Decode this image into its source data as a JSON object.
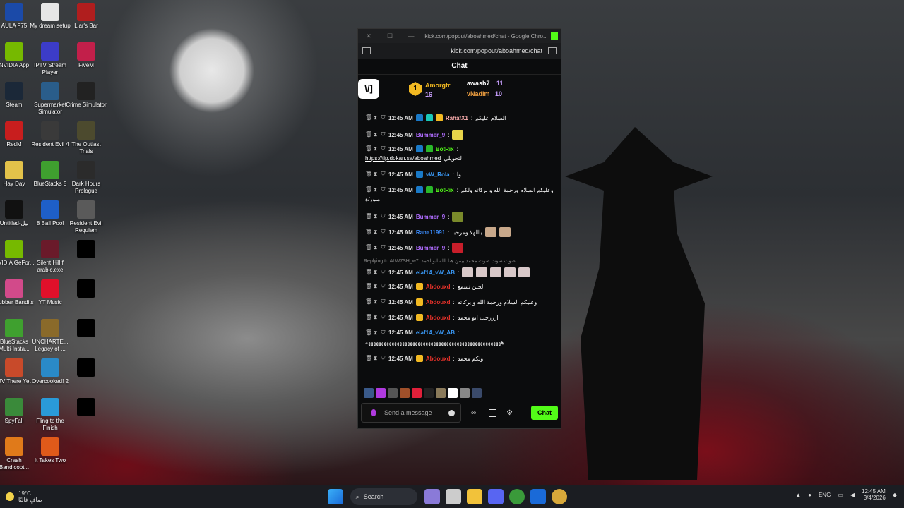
{
  "desktop": {
    "icons": [
      {
        "label": "AULA F75",
        "color": "#1b4aa8"
      },
      {
        "label": "My dream setup",
        "color": "#e6e6e6"
      },
      {
        "label": "Liar's Bar",
        "color": "#b01e1e"
      },
      {
        "label": "NVIDIA App",
        "color": "#76b900"
      },
      {
        "label": "IPTV Stream Player",
        "color": "#3c3cc8"
      },
      {
        "label": "FiveM",
        "color": "#c21f4a"
      },
      {
        "label": "Steam",
        "color": "#1b2838"
      },
      {
        "label": "Supermarket Simulator",
        "color": "#2a5d8a"
      },
      {
        "label": "Crime Simulator",
        "color": "#222222"
      },
      {
        "label": "RedM",
        "color": "#c81e1e"
      },
      {
        "label": "Resident Evil 4",
        "color": "#3a3a3a"
      },
      {
        "label": "The Outlast Trials",
        "color": "#4c4a2e"
      },
      {
        "label": "Hay Day",
        "color": "#e3c24a"
      },
      {
        "label": "BlueStacks 5",
        "color": "#3fa02f"
      },
      {
        "label": "Dark Hours Prologue",
        "color": "#2b2b2b"
      },
      {
        "label": "Untitled-بيل",
        "color": "#111111"
      },
      {
        "label": "8 Ball Pool",
        "color": "#1e5fc8"
      },
      {
        "label": "Resident Evil Requiem",
        "color": "#5a5a5a"
      },
      {
        "label": "NVIDIA GeFor...",
        "color": "#76b900"
      },
      {
        "label": "Silent Hill f arabic.exe",
        "color": "#6a1a2a"
      },
      {
        "label": "",
        "color": "#000000"
      },
      {
        "label": "Rubber Bandits",
        "color": "#d24a8a"
      },
      {
        "label": "YT Music",
        "color": "#e0102a"
      },
      {
        "label": "",
        "color": "#000000"
      },
      {
        "label": "BlueStacks Multi-Insta...",
        "color": "#3fa02f"
      },
      {
        "label": "UNCHARTE... Legacy of ...",
        "color": "#8a6a2a"
      },
      {
        "label": "",
        "color": "#000000"
      },
      {
        "label": "RV There Yet",
        "color": "#c84a2a"
      },
      {
        "label": "Overcooked! 2",
        "color": "#2a8ac8"
      },
      {
        "label": "",
        "color": "#000000"
      },
      {
        "label": "SpyFall",
        "color": "#3a8a3a"
      },
      {
        "label": "Fling to the Finish",
        "color": "#2a9ad8"
      },
      {
        "label": "",
        "color": "#000000"
      },
      {
        "label": "Crash Bandicoot...",
        "color": "#e07a1a"
      },
      {
        "label": "It Takes Two",
        "color": "#e05a1a"
      }
    ]
  },
  "browser": {
    "window_title": "kick.com/popout/aboahmed/chat - Google Chro...",
    "url": "kick.com/popout/aboahmed/chat",
    "close_glyph": "✕",
    "restore_glyph": "☐",
    "min_glyph": "—"
  },
  "chat": {
    "header": "Chat",
    "logo_text": "\\/]",
    "gifter_rank": "1",
    "gifters": {
      "first": {
        "name": "Amorgtr",
        "count": "16"
      },
      "second": {
        "name": "awash7",
        "count": "11"
      },
      "third": {
        "name": "vNadim",
        "count": "10"
      }
    },
    "messages": [
      {
        "time": "12:45 AM",
        "user": "RahafX1",
        "color": "#ffb0b0",
        "text": "السلام عليكم",
        "badges": [
          "#1a7ac8",
          "#1ac8b8",
          "#f2b922"
        ]
      },
      {
        "time": "12:45 AM",
        "user": "Bummer_9",
        "color": "#b06cff",
        "text": "",
        "emotes": [
          "#e8d44a"
        ]
      },
      {
        "time": "12:45 AM",
        "user": "BotRix",
        "color": "#53fc18",
        "text": "",
        "badges": [
          "#1a7ac8",
          "#2ab82a"
        ],
        "line2_link": "https://tip.dokan.sa/aboahmed",
        "line2_text": "لتحويلي"
      },
      {
        "time": "12:45 AM",
        "user": "vW_Rola",
        "color": "#3a9af8",
        "text": "وا",
        "badges": [
          "#1a7ac8"
        ]
      },
      {
        "time": "12:45 AM",
        "user": "BotRix",
        "color": "#53fc18",
        "text": "وعليكم السلام ورحمة الله و بركاته ولكم",
        "badges": [
          "#1a7ac8",
          "#2ab82a"
        ],
        "line2_text": "منور/ة"
      },
      {
        "time": "12:45 AM",
        "user": "Bummer_9",
        "color": "#b06cff",
        "text": "",
        "emotes": [
          "#7a8a2a"
        ]
      },
      {
        "time": "12:45 AM",
        "user": "Rana11991",
        "color": "#3a8af8",
        "text": "ياالهلا ومرحبا",
        "emotes": [
          "#c8a88a",
          "#c8a88a"
        ]
      },
      {
        "time": "12:45 AM",
        "user": "Bummer_9",
        "color": "#b06cff",
        "text": "",
        "emotes": [
          "#c81e2a"
        ]
      },
      {
        "time": "12:45 AM",
        "user": "elaf14_vW_AB",
        "color": "#3a9af8",
        "text": "",
        "reply": "Replying to ALW7SH_w7: صوت صوت صوت محمد بيتنن هنا الله ابو احمد",
        "emotes": [
          "#d8c8c8",
          "#d8c8c8",
          "#d8c8c8",
          "#d8c8c8",
          "#d8c8c8"
        ]
      },
      {
        "time": "12:45 AM",
        "user": "Abdouxd",
        "color": "#e8322a",
        "text": "الجين تسمع",
        "badges": [
          "#f2b922"
        ]
      },
      {
        "time": "12:45 AM",
        "user": "Abdouxd",
        "color": "#e8322a",
        "text": "وعليكم السلام ورحمة الله و بركاته",
        "badges": [
          "#f2b922"
        ]
      },
      {
        "time": "12:45 AM",
        "user": "Abdouxd",
        "color": "#e8322a",
        "text": "ارررحب ابو محمد",
        "badges": [
          "#f2b922"
        ]
      },
      {
        "time": "12:45 AM",
        "user": "elaf14_vW_AB",
        "color": "#3a9af8",
        "text": "",
        "line2_text": "ههههههههههههههههههههههههههههههههههههههههههههههههههههه"
      },
      {
        "time": "12:45 AM",
        "user": "Abdouxd",
        "color": "#e8322a",
        "text": "ولكم محمد",
        "badges": [
          "#f2b922"
        ]
      }
    ],
    "emote_bar": [
      "#3a5a8a",
      "#b03adf",
      "#555555",
      "#a0502a",
      "#e0203a",
      "#222222",
      "#8a7a5a",
      "#ffffff",
      "#888888",
      "#3a4a6a"
    ],
    "input_placeholder": "Send a message",
    "send_label": "Chat"
  },
  "taskbar": {
    "weather_temp": "19°C",
    "weather_desc": "صافٍ غالبًا",
    "search_label": "Search",
    "lang": "ENG",
    "time": "12:45 AM",
    "date": "3/4/2026"
  }
}
